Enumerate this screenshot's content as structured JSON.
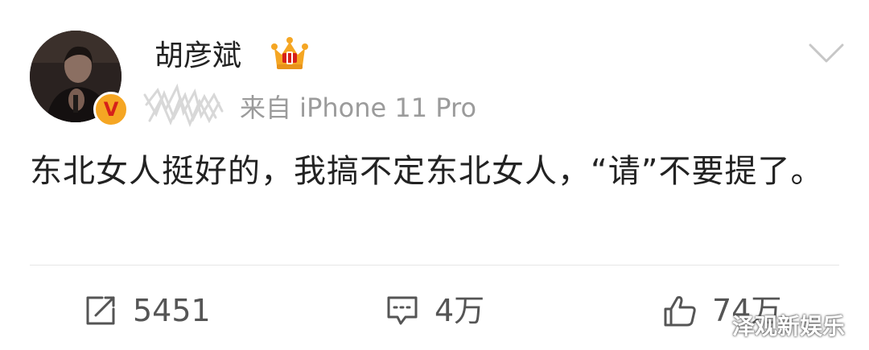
{
  "post": {
    "author": "胡彦斌",
    "source": "来自 iPhone 11 Pro",
    "text": "东北女人挺好的，我搞不定东北女人，“请”不要提了。",
    "verified_badge": "V"
  },
  "actions": {
    "repost_count": "5451",
    "comment_count": "4万",
    "like_count": "74万"
  },
  "overlay": {
    "site_watermark": "泽观新娱乐"
  },
  "icons": {
    "crown": "crown-icon",
    "chevron": "chevron-down-icon",
    "repost": "repost-icon",
    "comment": "comment-icon",
    "like": "thumbs-up-icon"
  },
  "colors": {
    "badge_bg": "#f5a623",
    "badge_text": "#d6201a",
    "crown": "#f5a623",
    "muted_text": "#9b9b9b",
    "icon_gray": "#555555"
  }
}
